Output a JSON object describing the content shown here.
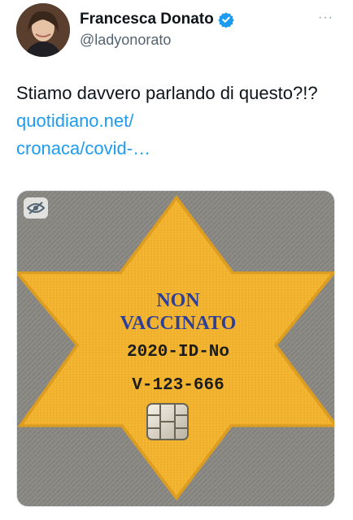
{
  "author": {
    "display_name": "Francesca Donato",
    "handle": "@ladyonorato",
    "verified": true
  },
  "tweet": {
    "text": "Stiamo davvero parlando di questo?!? ",
    "link_text": "quotidiano.net/\ncronaca/covid-…"
  },
  "media": {
    "image_text": {
      "line1": "NON",
      "line2": "VACCINATO",
      "line3": "2020-ID-No",
      "line4": "V-123-666"
    },
    "badge_icon": "eye-slash-icon"
  },
  "colors": {
    "link": "#1d9bf0",
    "verified": "#1d9bf0",
    "star": "#f2b632",
    "star_text": "#2f3f95",
    "fabric": "#8b8a86"
  },
  "icons": {
    "more": "more-icon",
    "verified": "verified-badge-icon"
  }
}
